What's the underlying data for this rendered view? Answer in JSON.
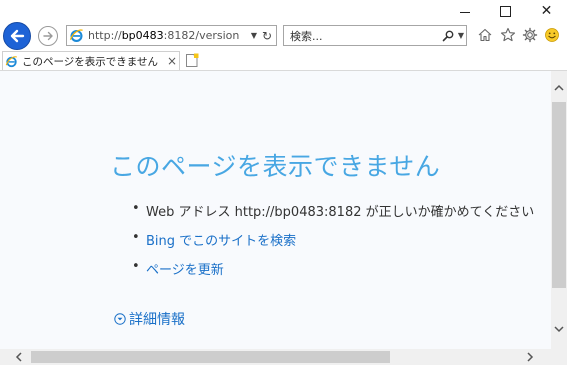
{
  "window": {
    "minimize_icon": "minimize-icon",
    "maximize_icon": "maximize-icon",
    "close_glyph": "✕"
  },
  "nav": {
    "address_prefix": "http://",
    "address_host": "bp0483",
    "address_rest": ":8182/version",
    "search_placeholder": "検索..."
  },
  "tab": {
    "title": "このページを表示できません",
    "close_glyph": "×"
  },
  "error_page": {
    "title": "このページを表示できません",
    "items": [
      {
        "text": "Web アドレス http://bp0483:8182 が正しいか確かめてください",
        "is_link": false
      },
      {
        "text": "Bing でこのサイトを検索",
        "is_link": true
      },
      {
        "text": "ページを更新",
        "is_link": true
      }
    ],
    "more_info": "詳細情報"
  },
  "colors": {
    "accent_blue": "#1e63d6",
    "title_blue": "#48a7e3",
    "link_blue": "#1a70c8",
    "page_background": "#f8fafd"
  }
}
